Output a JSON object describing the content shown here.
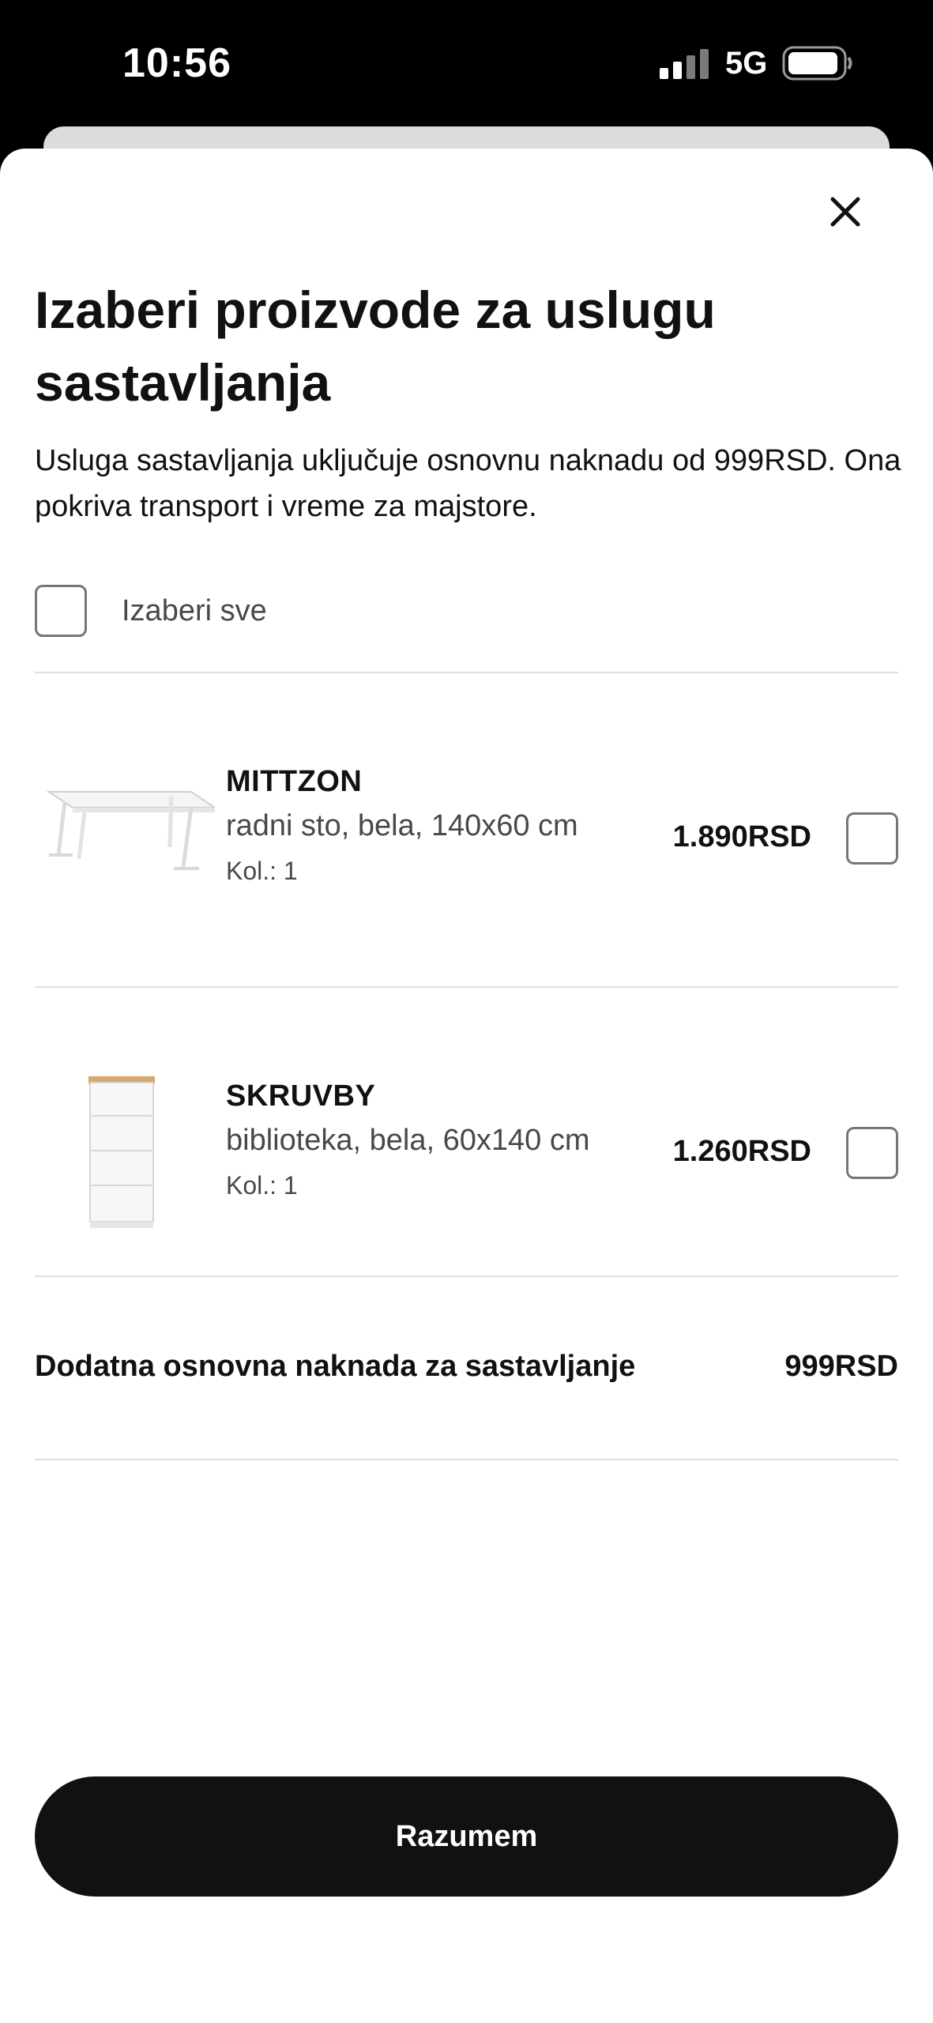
{
  "status_bar": {
    "time": "10:56",
    "network": "5G"
  },
  "modal": {
    "title": "Izaberi proizvode za uslugu sastavljanja",
    "description": "Usluga sastavljanja uključuje osnovnu naknadu od 999RSD. Ona pokriva transport i vreme za majstore.",
    "select_all_label": "Izaberi sve",
    "select_all_checked": false,
    "close_icon": "close-icon"
  },
  "products": [
    {
      "name": "MITTZON",
      "description": "radni sto, bela, 140x60 cm",
      "quantity": "Kol.: 1",
      "price": "1.890RSD",
      "checked": false,
      "image_icon": "desk-image"
    },
    {
      "name": "SKRUVBY",
      "description": "biblioteka, bela, 60x140 cm",
      "quantity": "Kol.: 1",
      "price": "1.260RSD",
      "checked": false,
      "image_icon": "bookcase-image"
    }
  ],
  "fee": {
    "label": "Dodatna osnovna naknada za sastavljanje",
    "price": "999RSD"
  },
  "primary_button": {
    "label": "Razumem"
  },
  "colors": {
    "primary_button_bg": "#111111",
    "text": "#111111",
    "secondary_text": "#484848",
    "divider": "#dfdfdf"
  }
}
